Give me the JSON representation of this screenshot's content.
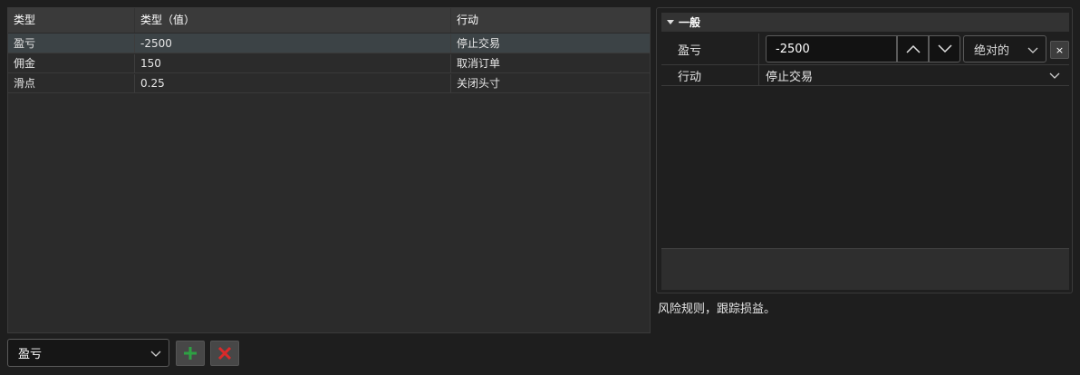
{
  "grid": {
    "columns": [
      "类型",
      "类型（值）",
      "行动"
    ],
    "rows": [
      {
        "type": "盈亏",
        "value": "-2500",
        "action": "停止交易",
        "selected": true
      },
      {
        "type": "佣金",
        "value": "150",
        "action": "取消订单",
        "selected": false
      },
      {
        "type": "滑点",
        "value": "0.25",
        "action": "关闭头寸",
        "selected": false
      }
    ]
  },
  "controls": {
    "type_select_value": "盈亏",
    "add_icon": "plus-icon",
    "delete_icon": "x-icon",
    "add_color": "#2ea043",
    "delete_color": "#d92a2a"
  },
  "props": {
    "section_title": "一般",
    "pnl_label": "盈亏",
    "pnl_value": "-2500",
    "mode_value": "绝对的",
    "clear_label": "×",
    "action_label": "行动",
    "action_value": "停止交易"
  },
  "description": "风险规则，跟踪损益。"
}
